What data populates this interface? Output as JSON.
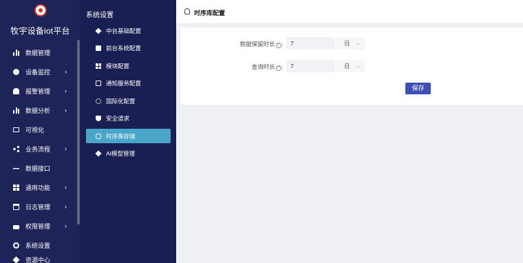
{
  "app": {
    "title": "牧宇设备iot平台",
    "logo_icon": "brand-logo"
  },
  "sidebar": {
    "items": [
      {
        "label": "数据管理",
        "icon": "grid-icon",
        "has_arrow": false
      },
      {
        "label": "设备监控",
        "icon": "monitor-icon",
        "has_arrow": true
      },
      {
        "label": "报警管理",
        "icon": "bell-icon",
        "has_arrow": true
      },
      {
        "label": "数据分析",
        "icon": "bar-chart-icon",
        "has_arrow": true
      },
      {
        "label": "可视化",
        "icon": "screen-icon",
        "has_arrow": false
      },
      {
        "label": "业务流程",
        "icon": "share-icon",
        "has_arrow": true
      },
      {
        "label": "数据接口",
        "icon": "link-icon",
        "has_arrow": false
      },
      {
        "label": "通用功能",
        "icon": "apps-icon",
        "has_arrow": true
      },
      {
        "label": "日志管理",
        "icon": "calendar-icon",
        "has_arrow": true
      },
      {
        "label": "权限管理",
        "icon": "lock-icon",
        "has_arrow": true
      },
      {
        "label": "系统设置",
        "icon": "gear-icon",
        "has_arrow": false
      },
      {
        "label": "资源中心",
        "icon": "cube-icon",
        "has_arrow": false
      }
    ],
    "arrow_glyph": "›"
  },
  "subnav": {
    "title": "系统设置",
    "items": [
      {
        "label": "中台基础配置",
        "icon": "cube-icon",
        "active": false
      },
      {
        "label": "前台系统配置",
        "icon": "document-icon",
        "active": false
      },
      {
        "label": "模块配置",
        "icon": "grid-icon",
        "active": false
      },
      {
        "label": "通知服务配置",
        "icon": "mail-icon",
        "active": false
      },
      {
        "label": "国际化配置",
        "icon": "globe-icon",
        "active": false
      },
      {
        "label": "安全请求",
        "icon": "shield-icon",
        "active": false
      },
      {
        "label": "时序库存储",
        "icon": "database-icon",
        "active": true
      },
      {
        "label": "AI模型管理",
        "icon": "cube-icon",
        "active": false
      }
    ]
  },
  "page": {
    "title": "时序库配置",
    "title_icon": "database-icon"
  },
  "form": {
    "retention": {
      "label": "数据保留时长",
      "suffix": ":",
      "value": "7",
      "unit": "日"
    },
    "query": {
      "label": "查询时长",
      "suffix": ":",
      "value": "7",
      "unit": "日"
    },
    "help_glyph": "?",
    "chevron_glyph": "⌄",
    "save_label": "保存"
  },
  "colors": {
    "sidebar_bg": "#1e2358",
    "subnav_bg": "#1a1f53",
    "active_item": "#4aa6c9",
    "primary_button": "#3d4fb5"
  }
}
